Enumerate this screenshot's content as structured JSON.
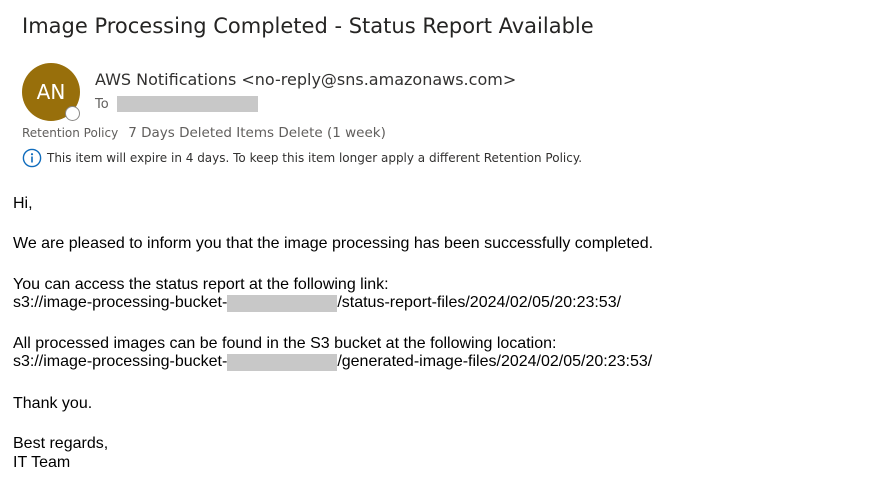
{
  "email": {
    "subject": "Image Processing Completed - Status Report Available",
    "sender": {
      "initials": "AN",
      "display": "AWS Notifications <no-reply@sns.amazonaws.com>",
      "avatar_color": "#986f0b"
    },
    "to_label": "To",
    "retention": {
      "label": "Retention Policy",
      "value": "7 Days Deleted Items Delete (1 week)"
    },
    "expiry_notice": "This item will expire in 4 days. To keep this item longer apply a different Retention Policy.",
    "body": {
      "greeting": "Hi,",
      "intro": "We are pleased to inform you that the image processing has been successfully completed.",
      "status_intro": "You can access the status report at the following link:",
      "status_link_prefix": "s3://image-processing-bucket-",
      "status_link_suffix": "/status-report-files/2024/02/05/20:23:53/",
      "images_intro": "All processed images can be found in the S3 bucket at the following location:",
      "images_link_prefix": "s3://image-processing-bucket-",
      "images_link_suffix": "/generated-image-files/2024/02/05/20:23:53/",
      "thanks": "Thank you.",
      "regards": "Best regards,",
      "signature": "IT Team"
    }
  }
}
